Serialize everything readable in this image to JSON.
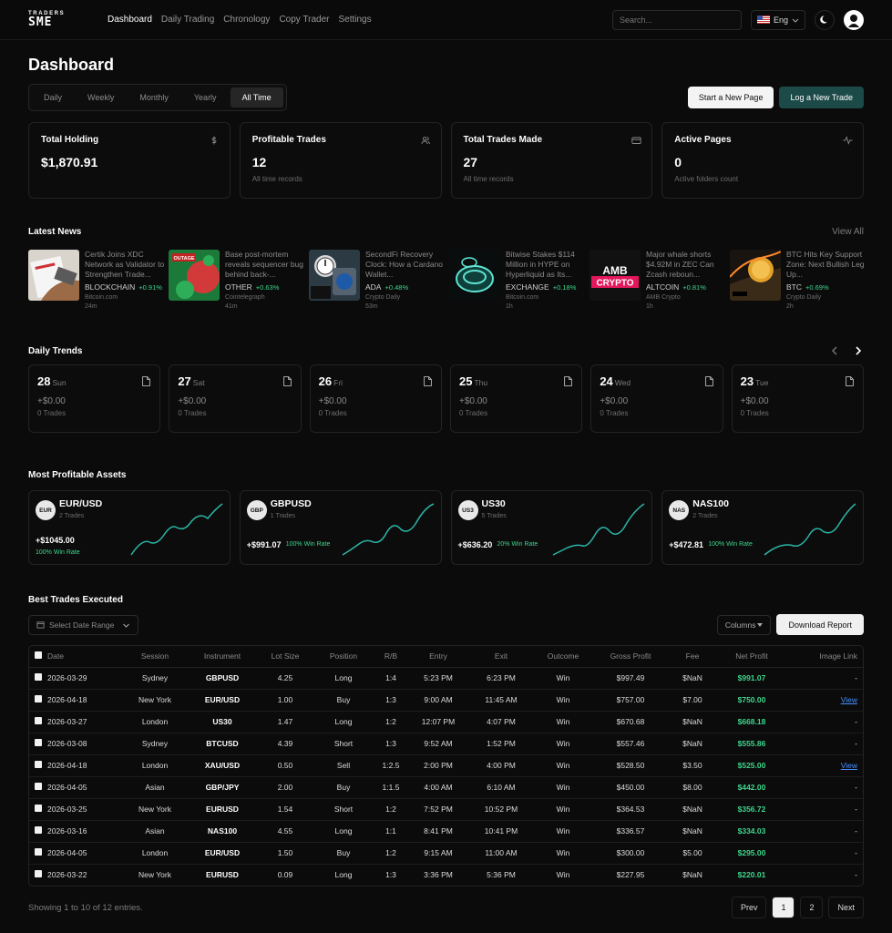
{
  "nav": {
    "logo_top": "TRADERS",
    "logo_bottom": "SME",
    "links": [
      {
        "label": "Dashboard",
        "active": true
      },
      {
        "label": "Daily Trading",
        "active": false
      },
      {
        "label": "Chronology",
        "active": false
      },
      {
        "label": "Copy Trader",
        "active": false
      },
      {
        "label": "Settings",
        "active": false
      }
    ],
    "search_placeholder": "Search...",
    "language": "Eng"
  },
  "page": {
    "title": "Dashboard",
    "range_tabs": [
      "Daily",
      "Weekly",
      "Monthly",
      "Yearly",
      "All Time"
    ],
    "active_range": "All Time",
    "start_page_label": "Start a New Page",
    "log_trade_label": "Log a New Trade"
  },
  "stats": [
    {
      "label": "Total Holding",
      "value": "$1,870.91",
      "sub": "",
      "icon": "dollar-icon"
    },
    {
      "label": "Profitable Trades",
      "value": "12",
      "sub": "All time records",
      "icon": "users-icon"
    },
    {
      "label": "Total Trades Made",
      "value": "27",
      "sub": "All time records",
      "icon": "card-icon"
    },
    {
      "label": "Active Pages",
      "value": "0",
      "sub": "Active folders count",
      "icon": "activity-icon"
    }
  ],
  "news": {
    "title": "Latest News",
    "view_all": "View All",
    "items": [
      {
        "title": "Certik Joins XDC Network as Validator to Strengthen Trade...",
        "category": "BLOCKCHAIN",
        "change": "+0.91%",
        "source": "Bitcoin.com",
        "time": "24m"
      },
      {
        "title": "Base post-mortem reveals sequencer bug behind back-...",
        "category": "OTHER",
        "change": "+0.63%",
        "source": "Cointelegraph",
        "time": "41m"
      },
      {
        "title": "SecondFi Recovery Clock: How a Cardano Wallet...",
        "category": "ADA",
        "change": "+0.48%",
        "source": "Crypto Daily",
        "time": "53m"
      },
      {
        "title": "Bitwise Stakes $114 Million in HYPE on Hyperliquid as Its...",
        "category": "EXCHANGE",
        "change": "+0.18%",
        "source": "Bitcoin.com",
        "time": "1h"
      },
      {
        "title": "Major whale shorts $4.92M in ZEC Can Zcash reboun...",
        "category": "ALTCOIN",
        "change": "+0.81%",
        "source": "AMB Crypto",
        "time": "1h"
      },
      {
        "title": "BTC Hits Key Support Zone: Next Bullish Leg Up...",
        "category": "BTC",
        "change": "+0.69%",
        "source": "Crypto Daily",
        "time": "2h"
      }
    ],
    "thumb_text": [
      "OUTAGE",
      "AMB",
      "CRYPTO"
    ]
  },
  "trends": {
    "title": "Daily Trends",
    "days": [
      {
        "num": "28",
        "name": "Sun",
        "value": "+$0.00",
        "trades": "0 Trades"
      },
      {
        "num": "27",
        "name": "Sat",
        "value": "+$0.00",
        "trades": "0 Trades"
      },
      {
        "num": "26",
        "name": "Fri",
        "value": "+$0.00",
        "trades": "0 Trades"
      },
      {
        "num": "25",
        "name": "Thu",
        "value": "+$0.00",
        "trades": "0 Trades"
      },
      {
        "num": "24",
        "name": "Wed",
        "value": "+$0.00",
        "trades": "0 Trades"
      },
      {
        "num": "23",
        "name": "Tue",
        "value": "+$0.00",
        "trades": "0 Trades"
      }
    ]
  },
  "assets": {
    "title": "Most Profitable Assets",
    "items": [
      {
        "badge": "EUR",
        "name": "EUR/USD",
        "trades": "2 Trades",
        "profit": "+$1045.00",
        "rate": "100% Win Rate",
        "stacked": true
      },
      {
        "badge": "GBP",
        "name": "GBPUSD",
        "trades": "1 Trades",
        "profit": "+$991.07",
        "rate": "100% Win Rate",
        "stacked": false
      },
      {
        "badge": "US3",
        "name": "US30",
        "trades": "5 Trades",
        "profit": "+$636.20",
        "rate": "20% Win Rate",
        "stacked": false
      },
      {
        "badge": "NAS",
        "name": "NAS100",
        "trades": "2 Trades",
        "profit": "+$472.81",
        "rate": "100% Win Rate",
        "stacked": false
      }
    ],
    "accent": "#2bb5a6"
  },
  "trades": {
    "title": "Best Trades Executed",
    "date_range_label": "Select Date Range",
    "columns_label": "Columns",
    "download_label": "Download Report",
    "headers": [
      "Date",
      "Session",
      "Instrument",
      "Lot Size",
      "Position",
      "R/B",
      "Entry",
      "Exit",
      "Outcome",
      "Gross Profit",
      "Fee",
      "Net Profit",
      "Image Link"
    ],
    "rows": [
      [
        "2026-03-29",
        "Sydney",
        "GBPUSD",
        "4.25",
        "Long",
        "1:4",
        "5:23 PM",
        "6:23 PM",
        "Win",
        "$997.49",
        "$NaN",
        "$991.07",
        "-"
      ],
      [
        "2026-04-18",
        "New York",
        "EUR/USD",
        "1.00",
        "Buy",
        "1:3",
        "9:00 AM",
        "11:45 AM",
        "Win",
        "$757.00",
        "$7.00",
        "$750.00",
        "View"
      ],
      [
        "2026-03-27",
        "London",
        "US30",
        "1.47",
        "Long",
        "1:2",
        "12:07 PM",
        "4:07 PM",
        "Win",
        "$670.68",
        "$NaN",
        "$668.18",
        "-"
      ],
      [
        "2026-03-08",
        "Sydney",
        "BTCUSD",
        "4.39",
        "Short",
        "1:3",
        "9:52 AM",
        "1:52 PM",
        "Win",
        "$557.46",
        "$NaN",
        "$555.86",
        "-"
      ],
      [
        "2026-04-18",
        "London",
        "XAU/USD",
        "0.50",
        "Sell",
        "1:2.5",
        "2:00 PM",
        "4:00 PM",
        "Win",
        "$528.50",
        "$3.50",
        "$525.00",
        "View"
      ],
      [
        "2026-04-05",
        "Asian",
        "GBP/JPY",
        "2.00",
        "Buy",
        "1:1.5",
        "4:00 AM",
        "6:10 AM",
        "Win",
        "$450.00",
        "$8.00",
        "$442.00",
        "-"
      ],
      [
        "2026-03-25",
        "New York",
        "EURUSD",
        "1.54",
        "Short",
        "1:2",
        "7:52 PM",
        "10:52 PM",
        "Win",
        "$364.53",
        "$NaN",
        "$356.72",
        "-"
      ],
      [
        "2026-03-16",
        "Asian",
        "NAS100",
        "4.55",
        "Long",
        "1:1",
        "8:41 PM",
        "10:41 PM",
        "Win",
        "$336.57",
        "$NaN",
        "$334.03",
        "-"
      ],
      [
        "2026-04-05",
        "London",
        "EUR/USD",
        "1.50",
        "Buy",
        "1:2",
        "9:15 AM",
        "11:00 AM",
        "Win",
        "$300.00",
        "$5.00",
        "$295.00",
        "-"
      ],
      [
        "2026-03-22",
        "New York",
        "EURUSD",
        "0.09",
        "Long",
        "1:3",
        "3:36 PM",
        "5:36 PM",
        "Win",
        "$227.95",
        "$NaN",
        "$220.01",
        "-"
      ]
    ],
    "footer": "Showing 1 to 10 of 12 entries.",
    "pager": {
      "prev": "Prev",
      "pages": [
        "1",
        "2"
      ],
      "active": "1",
      "next": "Next"
    }
  }
}
